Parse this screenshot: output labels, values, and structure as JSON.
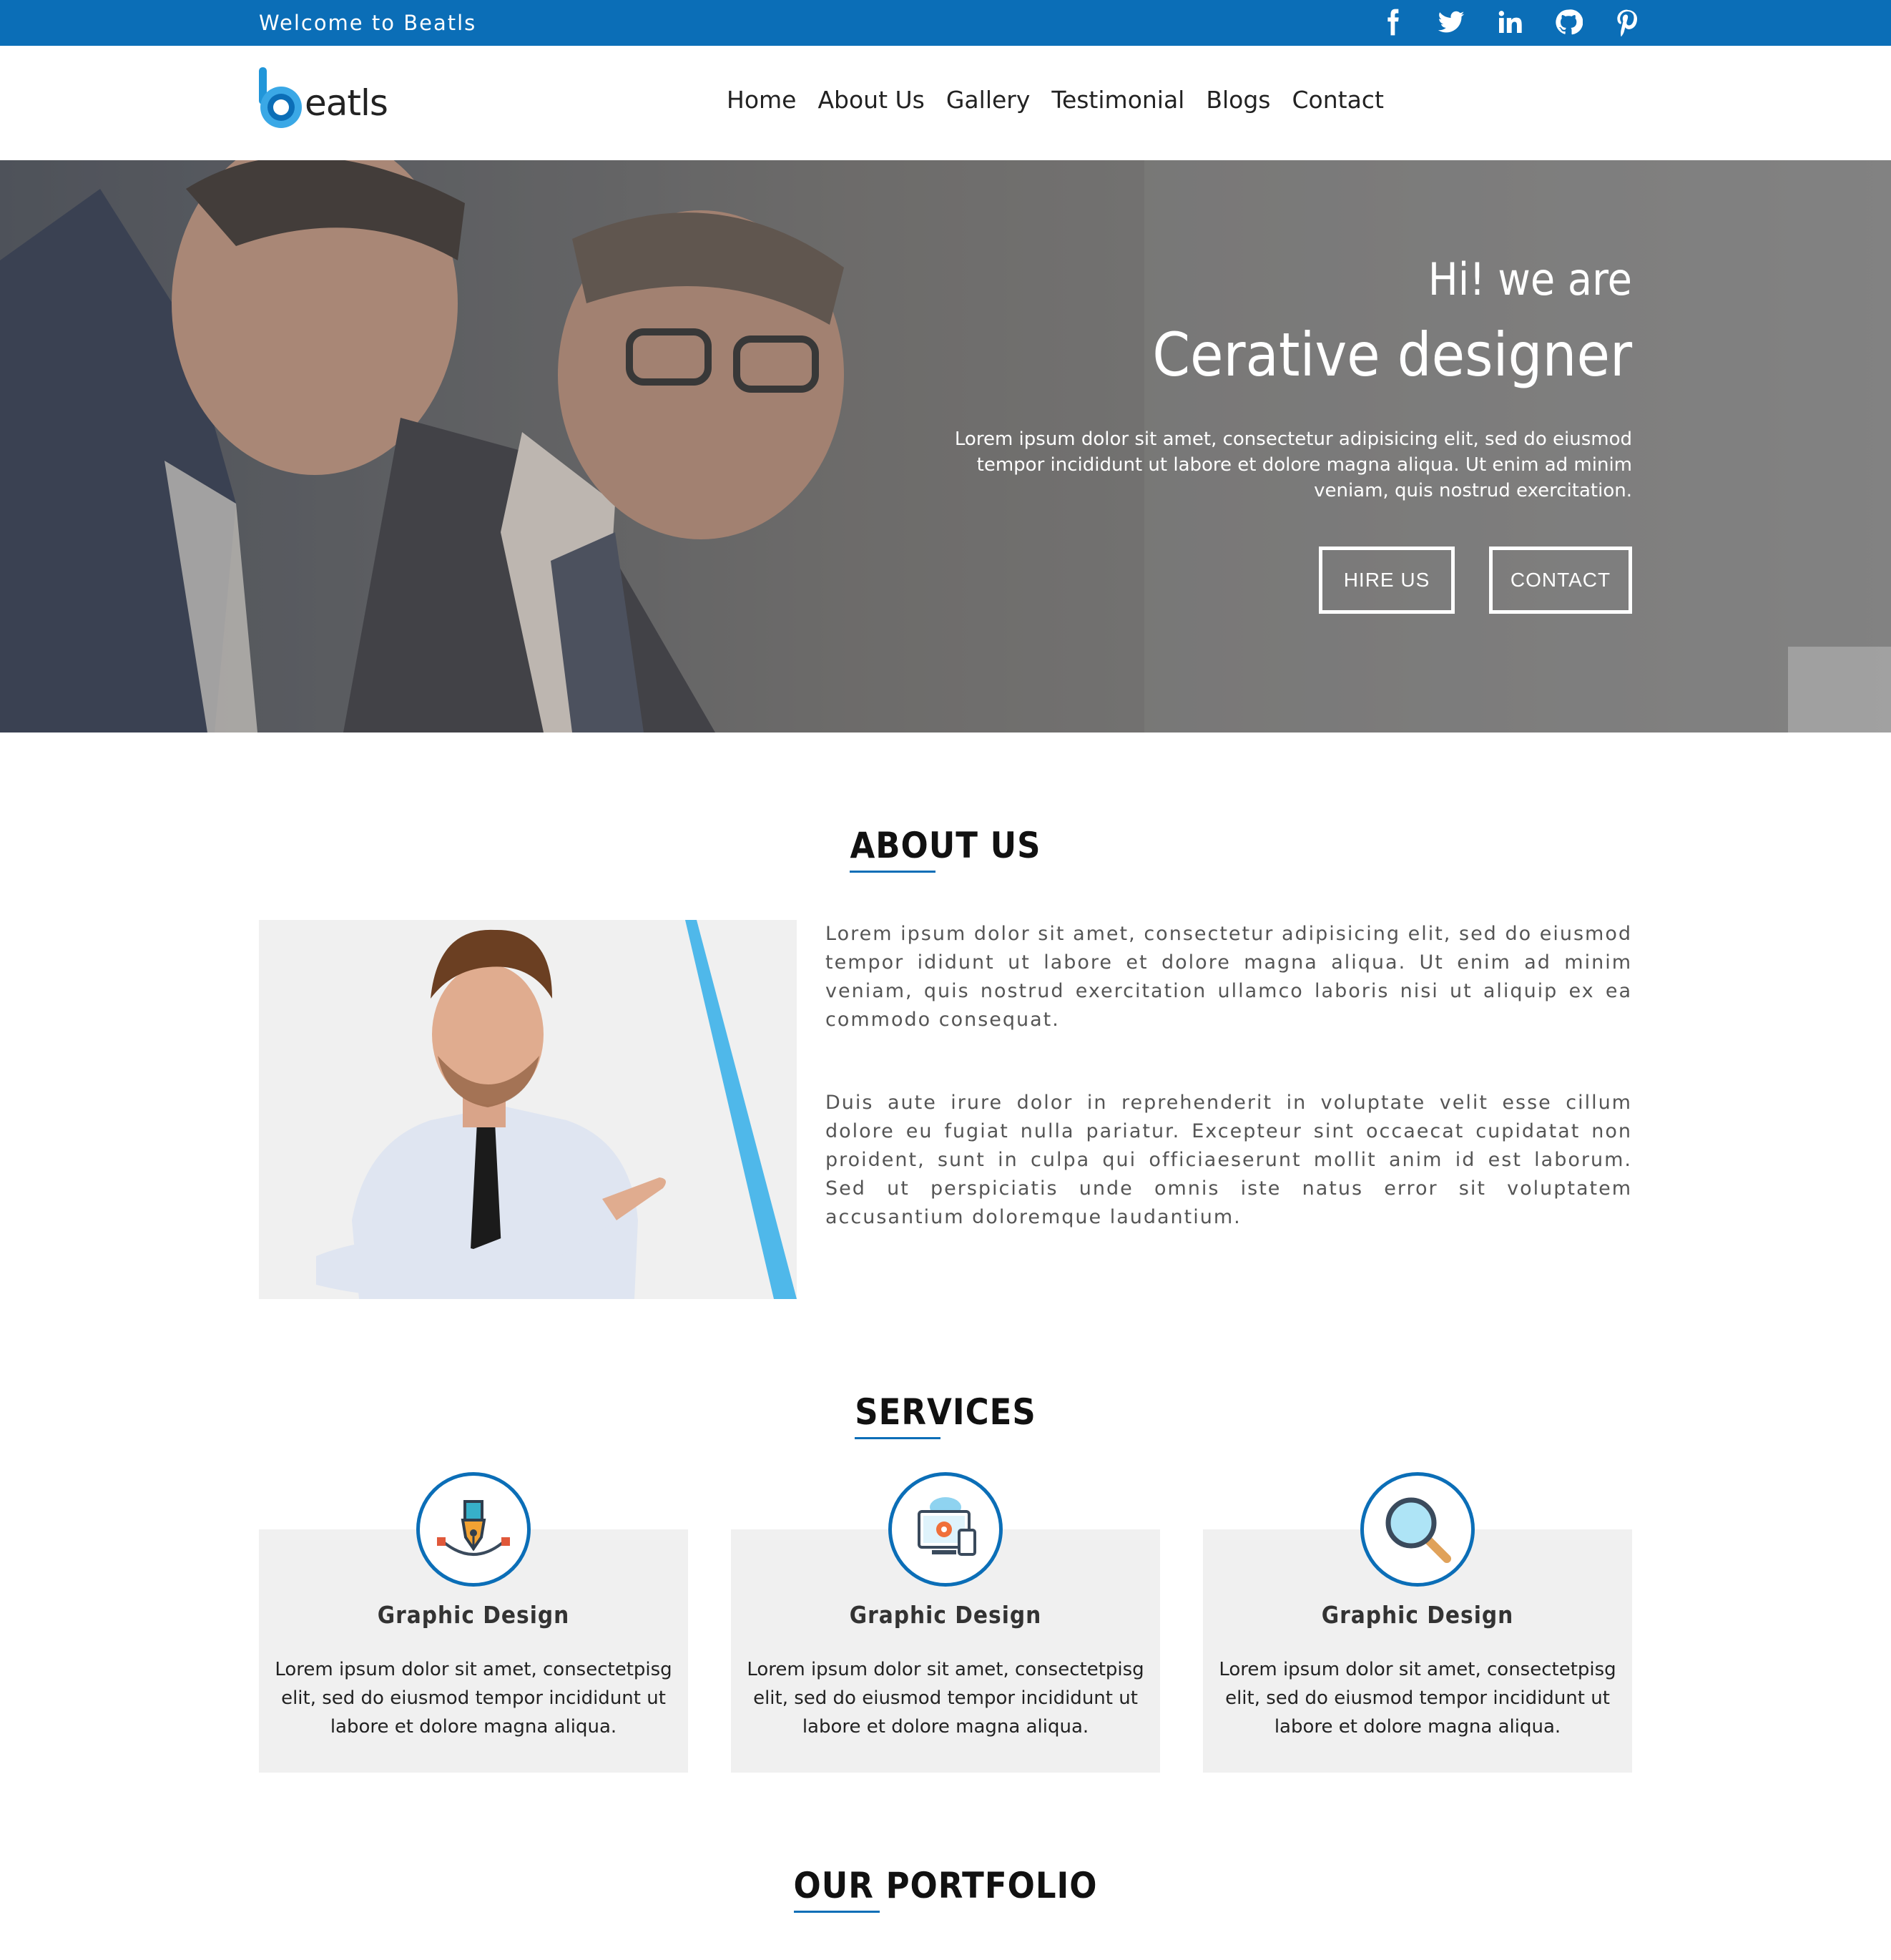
{
  "topbar": {
    "welcome": "Welcome to Beatls",
    "social_icons": [
      "facebook-icon",
      "twitter-icon",
      "linkedin-icon",
      "github-icon",
      "pinterest-icon"
    ],
    "background_color": "#0b6eb7"
  },
  "header": {
    "logo_text": "eatls",
    "nav": [
      "Home",
      "About Us",
      "Gallery",
      "Testimonial",
      "Blogs",
      "Contact"
    ]
  },
  "hero": {
    "greeting": "Hi! we are",
    "title": "Cerative designer",
    "description": "Lorem ipsum dolor sit amet, consectetur adipisicing elit, sed do eiusmod tempor incididunt ut labore et dolore magna aliqua. Ut enim ad minim veniam, quis nostrud exercitation.",
    "buttons": {
      "hire": "HIRE US",
      "contact": "CONTACT"
    }
  },
  "about": {
    "title": "ABOUT US",
    "paragraphs": [
      "Lorem ipsum dolor sit amet, consectetur adipisicing elit, sed do eiusmod tempor ididunt ut labore et dolore magna aliqua. Ut enim ad minim veniam, quis nostrud exercitation ullamco laboris nisi ut aliquip ex ea commodo consequat.",
      "Duis aute irure dolor in reprehenderit in voluptate velit esse cillum dolore eu fugiat nulla pariatur. Excepteur sint occaecat cupidatat non proident, sunt in culpa qui officiaeserunt mollit anim id est laborum. Sed ut perspiciatis unde omnis iste natus error sit voluptatem accusantium doloremque laudantium."
    ]
  },
  "services": {
    "title": "SERVICES",
    "items": [
      {
        "icon": "pen-tool-icon",
        "title": "Graphic Design",
        "description": "Lorem ipsum dolor sit amet, consectetpisg elit, sed do eiusmod tempor incididunt ut labore et dolore magna aliqua."
      },
      {
        "icon": "devices-settings-icon",
        "title": "Graphic Design",
        "description": "Lorem ipsum dolor sit amet, consectetpisg elit, sed do eiusmod tempor incididunt ut labore et dolore magna aliqua."
      },
      {
        "icon": "magnifier-icon",
        "title": "Graphic Design",
        "description": "Lorem ipsum dolor sit amet, consectetpisg elit, sed do eiusmod tempor incididunt ut labore et dolore magna aliqua."
      }
    ]
  },
  "portfolio": {
    "title": "OUR PORTFOLIO"
  },
  "colors": {
    "accent": "#0b6eb7",
    "light_blue": "#4fb8ea",
    "card_bg": "#f0f0f0"
  }
}
